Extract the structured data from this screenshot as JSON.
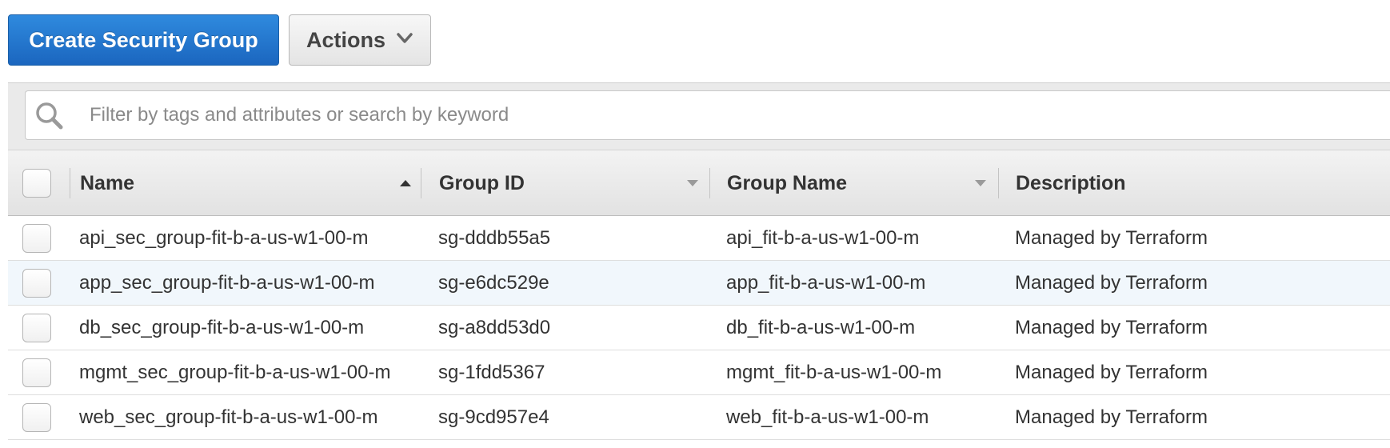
{
  "toolbar": {
    "create_label": "Create Security Group",
    "actions_label": "Actions"
  },
  "filter": {
    "placeholder": "Filter by tags and attributes or search by keyword",
    "value": ""
  },
  "table": {
    "columns": [
      "Name",
      "Group ID",
      "Group Name",
      "Description"
    ],
    "rows": [
      {
        "name": "api_sec_group-fit-b-a-us-w1-00-m",
        "group_id": "sg-dddb55a5",
        "group_name": "api_fit-b-a-us-w1-00-m",
        "description": "Managed by Terraform"
      },
      {
        "name": "app_sec_group-fit-b-a-us-w1-00-m",
        "group_id": "sg-e6dc529e",
        "group_name": "app_fit-b-a-us-w1-00-m",
        "description": "Managed by Terraform"
      },
      {
        "name": "db_sec_group-fit-b-a-us-w1-00-m",
        "group_id": "sg-a8dd53d0",
        "group_name": "db_fit-b-a-us-w1-00-m",
        "description": "Managed by Terraform"
      },
      {
        "name": "mgmt_sec_group-fit-b-a-us-w1-00-m",
        "group_id": "sg-1fdd5367",
        "group_name": "mgmt_fit-b-a-us-w1-00-m",
        "description": "Managed by Terraform"
      },
      {
        "name": "web_sec_group-fit-b-a-us-w1-00-m",
        "group_id": "sg-9cd957e4",
        "group_name": "web_fit-b-a-us-w1-00-m",
        "description": "Managed by Terraform"
      }
    ]
  },
  "colors": {
    "primary": "#1b66bf",
    "row_hover": "#f1f7fc",
    "header_bg": "#e2e2e2"
  },
  "icons": {
    "search": "search-icon",
    "actions_caret": "chevron-down-icon",
    "sort_asc": "sort-ascending-icon",
    "sort_menu": "sort-dropdown-icon"
  }
}
